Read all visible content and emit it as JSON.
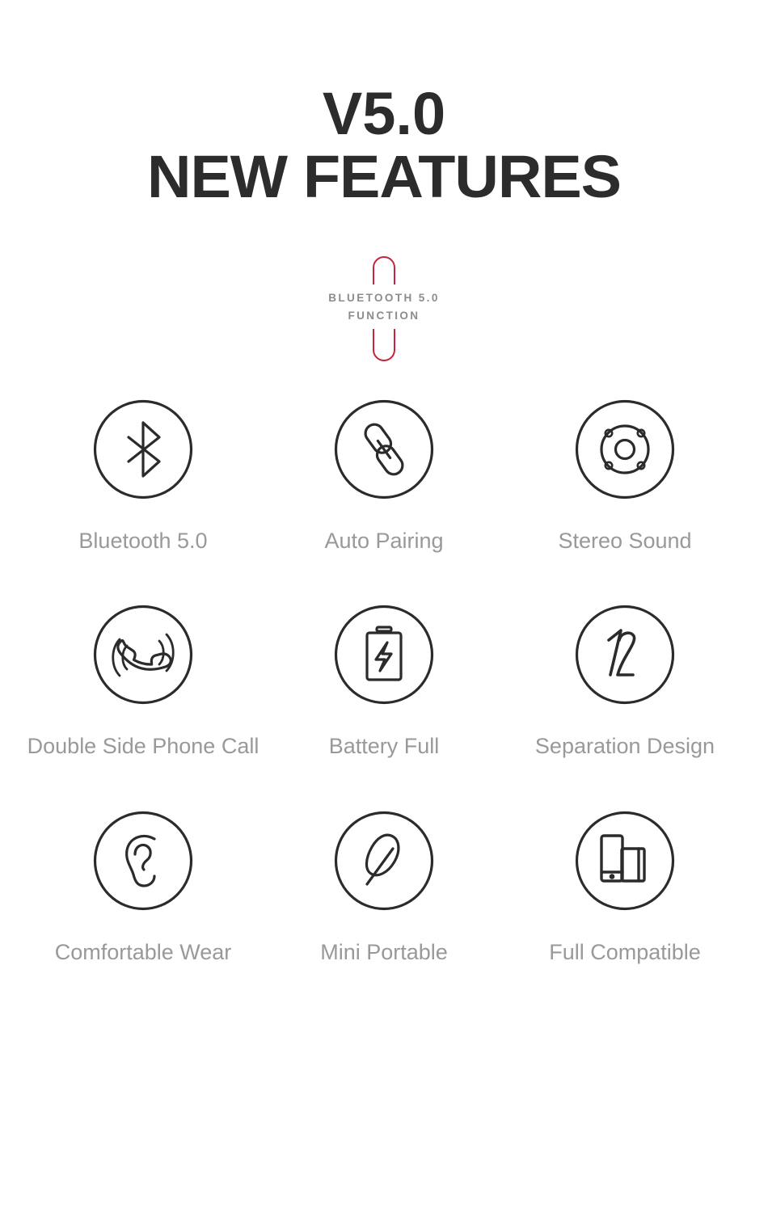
{
  "header": {
    "title_line_1": "V5.0",
    "title_line_2": "NEW FEATURES"
  },
  "badge": {
    "line_1": "BLUETOOTH 5.0",
    "line_2": "FUNCTION",
    "accent_color": "#c4243e",
    "text_color": "#8c8c8c"
  },
  "colors": {
    "background": "#ffffff",
    "title": "#2c2c2c",
    "icon_stroke": "#2b2b2b",
    "label": "#999999",
    "accent_red": "#c4243e"
  },
  "features": [
    {
      "label": "Bluetooth 5.0",
      "icon": "bluetooth-icon"
    },
    {
      "label": "Auto Pairing",
      "icon": "chain-link-icon"
    },
    {
      "label": "Stereo Sound",
      "icon": "speaker-driver-icon"
    },
    {
      "label": "Double Side Phone Call",
      "icon": "phone-call-waves-icon"
    },
    {
      "label": "Battery Full",
      "icon": "battery-bolt-icon"
    },
    {
      "label": "Separation Design",
      "icon": "one-two-separation-icon"
    },
    {
      "label": "Comfortable Wear",
      "icon": "ear-icon"
    },
    {
      "label": "Mini Portable",
      "icon": "feather-icon"
    },
    {
      "label": "Full Compatible",
      "icon": "tablet-phone-icon"
    }
  ]
}
